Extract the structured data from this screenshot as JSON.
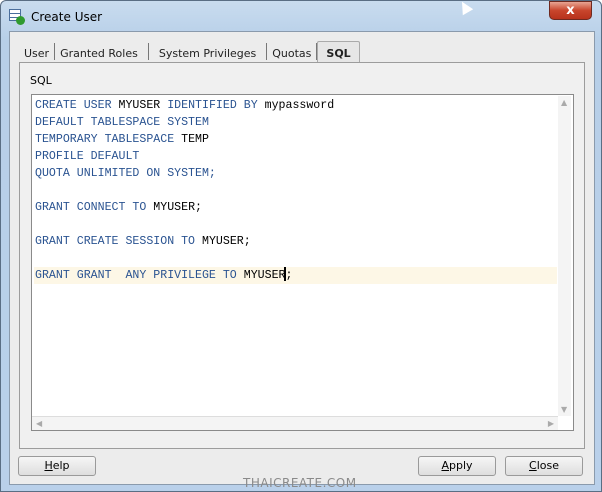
{
  "window": {
    "title": "Create User",
    "close_label": "x"
  },
  "tabs": [
    {
      "label": "User"
    },
    {
      "label": "Granted Roles"
    },
    {
      "label": "System Privileges"
    },
    {
      "label": "Quotas"
    },
    {
      "label": "SQL",
      "active": true
    }
  ],
  "panel": {
    "label": "SQL"
  },
  "sql_lines": [
    [
      [
        "kw",
        "CREATE USER "
      ],
      [
        "id",
        "MYUSER "
      ],
      [
        "kw",
        "IDENTIFIED BY "
      ],
      [
        "id",
        "mypassword"
      ]
    ],
    [
      [
        "kw",
        "DEFAULT TABLESPACE SYSTEM"
      ]
    ],
    [
      [
        "kw",
        "TEMPORARY TABLESPACE "
      ],
      [
        "id",
        "TEMP"
      ]
    ],
    [
      [
        "kw",
        "PROFILE DEFAULT"
      ]
    ],
    [
      [
        "kw",
        "QUOTA UNLIMITED ON SYSTEM;"
      ]
    ],
    [],
    [
      [
        "kw",
        "GRANT CONNECT TO "
      ],
      [
        "id",
        "MYUSER;"
      ]
    ],
    [],
    [
      [
        "kw",
        "GRANT CREATE SESSION TO "
      ],
      [
        "id",
        "MYUSER;"
      ]
    ],
    [],
    [
      [
        "kw",
        "GRANT GRANT  ANY PRIVILEGE TO "
      ],
      [
        "id",
        "MYUSER"
      ],
      [
        "caret",
        ""
      ],
      [
        "id",
        ";"
      ]
    ]
  ],
  "highlighted_line": 10,
  "buttons": {
    "help": {
      "mnemonic": "H",
      "rest": "elp"
    },
    "apply": {
      "mnemonic": "A",
      "rest": "pply"
    },
    "close": {
      "mnemonic": "C",
      "rest": "lose"
    }
  },
  "watermark": "THAICREATE.COM"
}
